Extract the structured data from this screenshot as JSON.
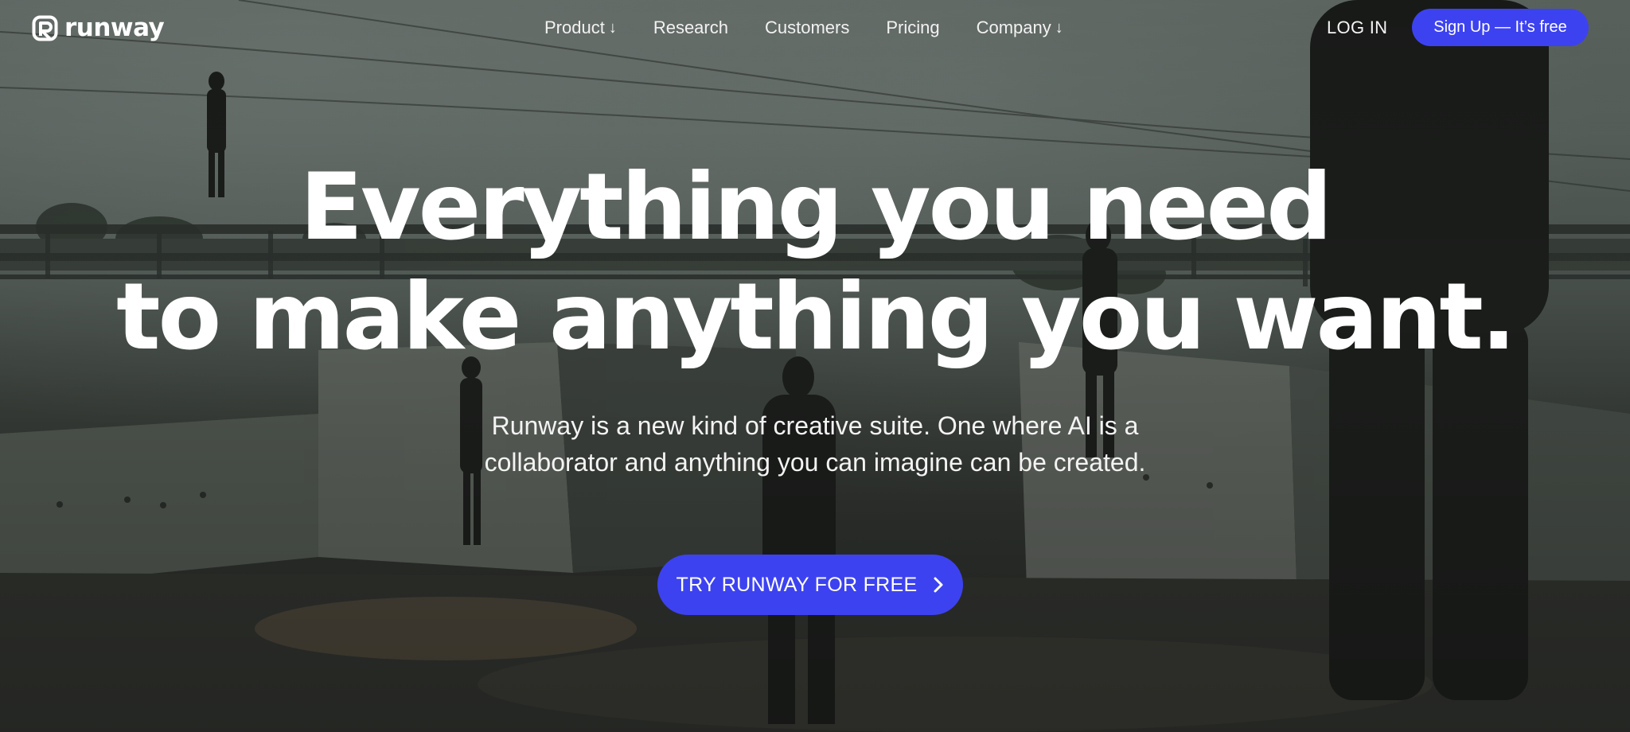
{
  "header": {
    "logo_text": "runway",
    "nav": [
      {
        "label": "Product",
        "has_dropdown": true,
        "arrow": "↓"
      },
      {
        "label": "Research",
        "has_dropdown": false
      },
      {
        "label": "Customers",
        "has_dropdown": false
      },
      {
        "label": "Pricing",
        "has_dropdown": false
      },
      {
        "label": "Company",
        "has_dropdown": true,
        "arrow": "↓"
      }
    ],
    "login_label": "LOG IN",
    "signup_label": "Sign Up — It’s free"
  },
  "hero": {
    "title_line1": "Everything you need",
    "title_line2": "to make anything you want.",
    "subtitle_line1": "Runway is a new kind of creative suite. One where AI is a",
    "subtitle_line2": "collaborator and anything you can imagine can be created.",
    "cta_label": "TRY RUNWAY FOR FREE",
    "cta_icon": "chevron-right-icon"
  },
  "colors": {
    "accent": "#3d42f0",
    "text": "#ffffff"
  }
}
